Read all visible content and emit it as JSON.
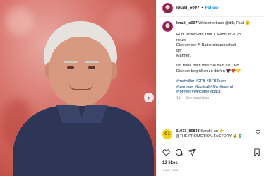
{
  "post": {
    "username": "khalil_o007",
    "separator": "•",
    "follow_label": "Follow",
    "more_label": "···"
  },
  "caption": {
    "username": "khalil_o007",
    "intro": "Welcome back @dfb, Rudi 🫡",
    "lines": [
      "Rudi Völler wird zum 1. Februar 2023",
      "neuer",
      "Direktor der A-Nationalmannschaft",
      "der",
      "Männer.",
      "",
      "Ich freue mich total Sie bald als DFB",
      "Direktor begrüßen zu dürfen 🖤❤️💛",
      ""
    ],
    "hashtags": [
      "#rudivöller #DFB #DFBTeam",
      "#germany #football #fifa #legend",
      "#forever #welcome #back"
    ],
    "age": "1d",
    "see_translation": "See translation"
  },
  "comment": {
    "avatar_text": "C1",
    "username": "81073_86833",
    "text": "Send it on 👉",
    "mention": "@THE.PROMOTION.FACTORY 💰💲"
  },
  "stats": {
    "likes": "12 likes",
    "time_ago": "1 DAY AGO"
  },
  "colors": {
    "accent": "#0095f6",
    "hashtag": "#00376b",
    "muted": "#8e8e8e"
  }
}
